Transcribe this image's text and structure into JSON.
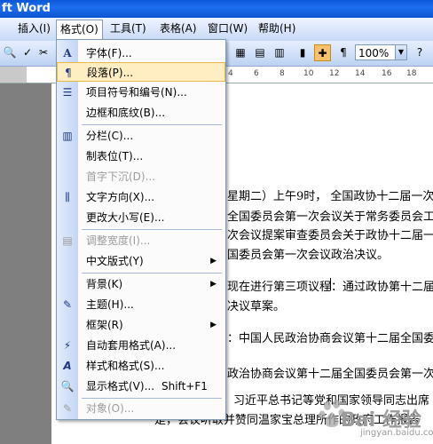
{
  "window": {
    "title": "ft Word"
  },
  "menubar": {
    "items": [
      "插入(I)",
      "格式(O)",
      "工具(T)",
      "表格(A)",
      "窗口(W)",
      "帮助(H)"
    ],
    "active": "格式(O)"
  },
  "toolbar": {
    "zoom": "100%",
    "zoom_arrow": "▼"
  },
  "ruler": {
    "ticks": [
      "4",
      "6",
      "8",
      "10",
      "12",
      "14",
      "16",
      "18"
    ]
  },
  "format_menu": {
    "items": [
      {
        "icon": "A",
        "label": "字体(F)...",
        "enabled": true
      },
      {
        "icon": "¶",
        "label": "段落(P)...",
        "enabled": true,
        "highlighted": true
      },
      {
        "icon": "☰",
        "label": "项目符号和编号(N)...",
        "enabled": true
      },
      {
        "icon": "",
        "label": "边框和底纹(B)...",
        "enabled": true
      },
      {
        "icon": "▥",
        "label": "分栏(C)...",
        "enabled": true
      },
      {
        "icon": "",
        "label": "制表位(T)...",
        "enabled": true
      },
      {
        "icon": "",
        "label": "首字下沉(D)...",
        "enabled": false
      },
      {
        "icon": "⫼",
        "label": "文字方向(X)...",
        "enabled": true
      },
      {
        "icon": "",
        "label": "更改大小写(E)...",
        "enabled": true
      },
      {
        "icon": "▤",
        "label": "调整宽度(I)...",
        "enabled": false
      },
      {
        "icon": "",
        "label": "中文版式(Y)",
        "enabled": true,
        "submenu": true
      },
      {
        "icon": "",
        "label": "背景(K)",
        "enabled": true,
        "submenu": true
      },
      {
        "icon": "✎",
        "label": "主题(H)...",
        "enabled": true
      },
      {
        "icon": "",
        "label": "框架(R)",
        "enabled": true,
        "submenu": true
      },
      {
        "icon": "⚡",
        "label": "自动套用格式(A)...",
        "enabled": true
      },
      {
        "icon": "A",
        "label": "样式和格式(S)...",
        "enabled": true
      },
      {
        "icon": "🔍",
        "label": "显示格式(V)...",
        "shortcut": "Shift+F1",
        "enabled": true
      },
      {
        "icon": "✎",
        "label": "对象(O)...",
        "enabled": false
      }
    ]
  },
  "document": {
    "lines": [
      "星期二）上午9时， 全国政协十二届一次",
      "全国委员会第一次会议关于常务委员会工",
      "次会议提案审查委员会关于政协十二届一",
      "国委员会第一次会议政治决议。",
      "现在进行第三项议程：通过政协第十二届",
      "决议草案。",
      "：中国人民政治协商会议第十二届全国委",
      "政治协商会议第十二届全国委员会第一次",
      "会议期间，习近平总书记等党和国家领导同志出席",
      "是，会议听取并赞同温家宝总理所作的政府工作报告"
    ]
  },
  "watermark": {
    "text": "Bai 经验",
    "sub": "jingyan.baidu.com"
  }
}
